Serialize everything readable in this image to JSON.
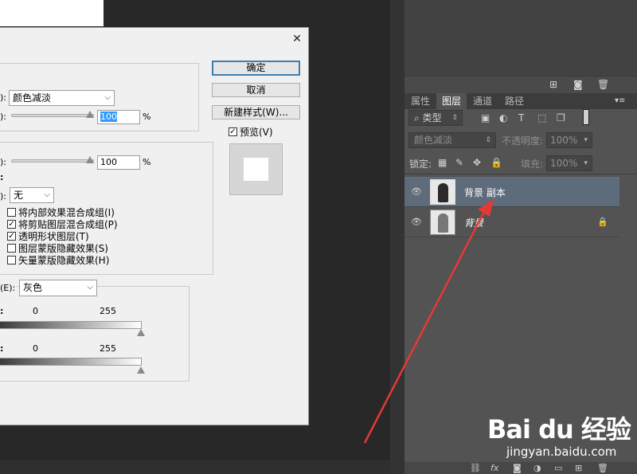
{
  "dialog": {
    "close_glyph": "✕",
    "blend_label_suffix": "):",
    "blend_mode": "颜色减淡",
    "opacity_value": "100",
    "fill_value": "100",
    "percent": "%",
    "knockout_label_suffix": "):",
    "knockout_value": "无",
    "checkboxes": [
      {
        "label": "将内部效果混合成组(I)",
        "checked": false
      },
      {
        "label": "将剪贴图层混合成组(P)",
        "checked": true
      },
      {
        "label": "透明形状图层(T)",
        "checked": true
      },
      {
        "label": "图层蒙版隐藏效果(S)",
        "checked": false
      },
      {
        "label": "矢量蒙版隐藏效果(H)",
        "checked": false
      }
    ],
    "blend_if_label": "(E):",
    "blend_if_value": "灰色",
    "this_layer_min": "0",
    "this_layer_max": "255",
    "under_layer_min": "0",
    "under_layer_max": "255",
    "ok_label": "确定",
    "cancel_label": "取消",
    "new_style_label": "新建样式(W)...",
    "preview_label": "预览(V)",
    "preview_checked": true
  },
  "layers_panel": {
    "tabs": [
      "属性",
      "图层",
      "通道",
      "路径"
    ],
    "active_tab": "图层",
    "filter_kind": "类型",
    "blend_mode": "颜色减淡",
    "opacity_label": "不透明度:",
    "opacity_value": "100%",
    "lock_label": "锁定:",
    "fill_label": "填充:",
    "fill_value": "100%",
    "layers": [
      {
        "name": "背景 副本",
        "selected": true,
        "locked": false
      },
      {
        "name": "背景",
        "selected": false,
        "locked": true
      }
    ]
  },
  "watermark": {
    "brand": "Bai du 经验",
    "url": "jingyan.baidu.com"
  },
  "colors": {
    "accent_arrow": "#e53935",
    "selected_layer": "#5d6b7a",
    "panel_bg": "#535353",
    "dialog_bg": "#f0f0f0"
  }
}
